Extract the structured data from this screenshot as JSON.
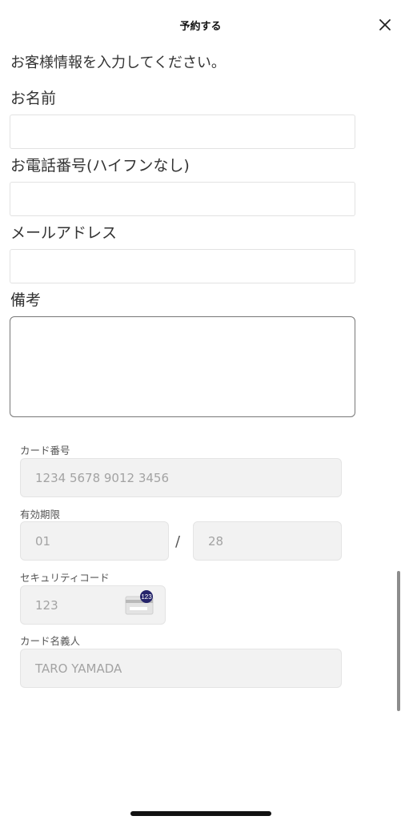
{
  "header": {
    "title": "予約する",
    "close_icon": "close-icon"
  },
  "form": {
    "intro": "お客様情報を入力してください。",
    "name_label": "お名前",
    "name_value": "",
    "phone_label": "お電話番号(ハイフンなし)",
    "phone_value": "",
    "email_label": "メールアドレス",
    "email_value": "",
    "notes_label": "備考",
    "notes_value": ""
  },
  "card": {
    "number_label": "カード番号",
    "number_placeholder": "1234 5678 9012 3456",
    "expiry_label": "有効期限",
    "expiry_month_placeholder": "01",
    "expiry_separator": "/",
    "expiry_year_placeholder": "28",
    "security_label": "セキュリティコード",
    "security_placeholder": "123",
    "security_icon": "card-cvc-icon",
    "security_badge": "123",
    "holder_label": "カード名義人",
    "holder_placeholder": "TARO YAMADA"
  }
}
